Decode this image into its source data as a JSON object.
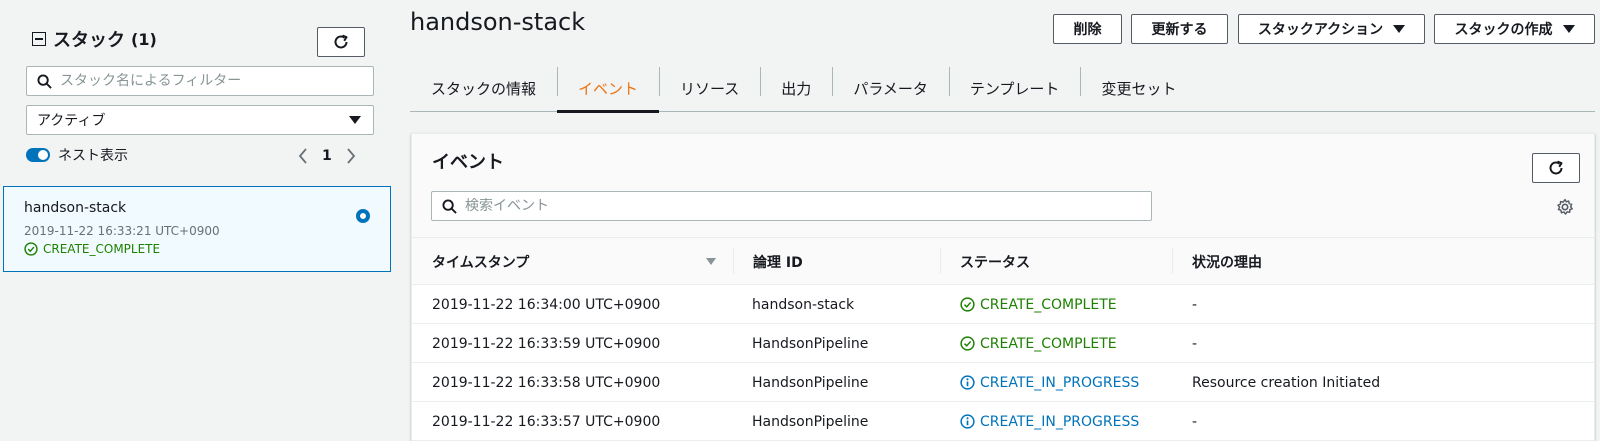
{
  "sidebar": {
    "title": "スタック",
    "count": "(1)",
    "search_placeholder": "スタック名によるフィルター",
    "filter_value": "アクティブ",
    "nested_label": "ネスト表示",
    "page": "1",
    "stacks": [
      {
        "name": "handson-stack",
        "time": "2019-11-22 16:33:21 UTC+0900",
        "status": "CREATE_COMPLETE"
      }
    ]
  },
  "stack": {
    "title": "handson-stack",
    "actions": {
      "delete": "削除",
      "update": "更新する",
      "stack_actions": "スタックアクション",
      "create_stack": "スタックの作成"
    },
    "tabs": [
      "スタックの情報",
      "イベント",
      "リソース",
      "出力",
      "パラメータ",
      "テンプレート",
      "変更セット"
    ],
    "active_tab": "イベント"
  },
  "events": {
    "title": "イベント",
    "search_placeholder": "検索イベント",
    "columns": [
      "タイムスタンプ",
      "論理 ID",
      "ステータス",
      "状況の理由"
    ],
    "rows": [
      {
        "timestamp": "2019-11-22 16:34:00 UTC+0900",
        "logical_id": "handson-stack",
        "status": "CREATE_COMPLETE",
        "reason": "-"
      },
      {
        "timestamp": "2019-11-22 16:33:59 UTC+0900",
        "logical_id": "HandsonPipeline",
        "status": "CREATE_COMPLETE",
        "reason": "-"
      },
      {
        "timestamp": "2019-11-22 16:33:58 UTC+0900",
        "logical_id": "HandsonPipeline",
        "status": "CREATE_IN_PROGRESS",
        "reason": "Resource creation Initiated"
      },
      {
        "timestamp": "2019-11-22 16:33:57 UTC+0900",
        "logical_id": "HandsonPipeline",
        "status": "CREATE_IN_PROGRESS",
        "reason": "-"
      }
    ]
  },
  "colors": {
    "accent": "#ec7211",
    "link_blue": "#0073bb",
    "success_green": "#1d8102"
  }
}
